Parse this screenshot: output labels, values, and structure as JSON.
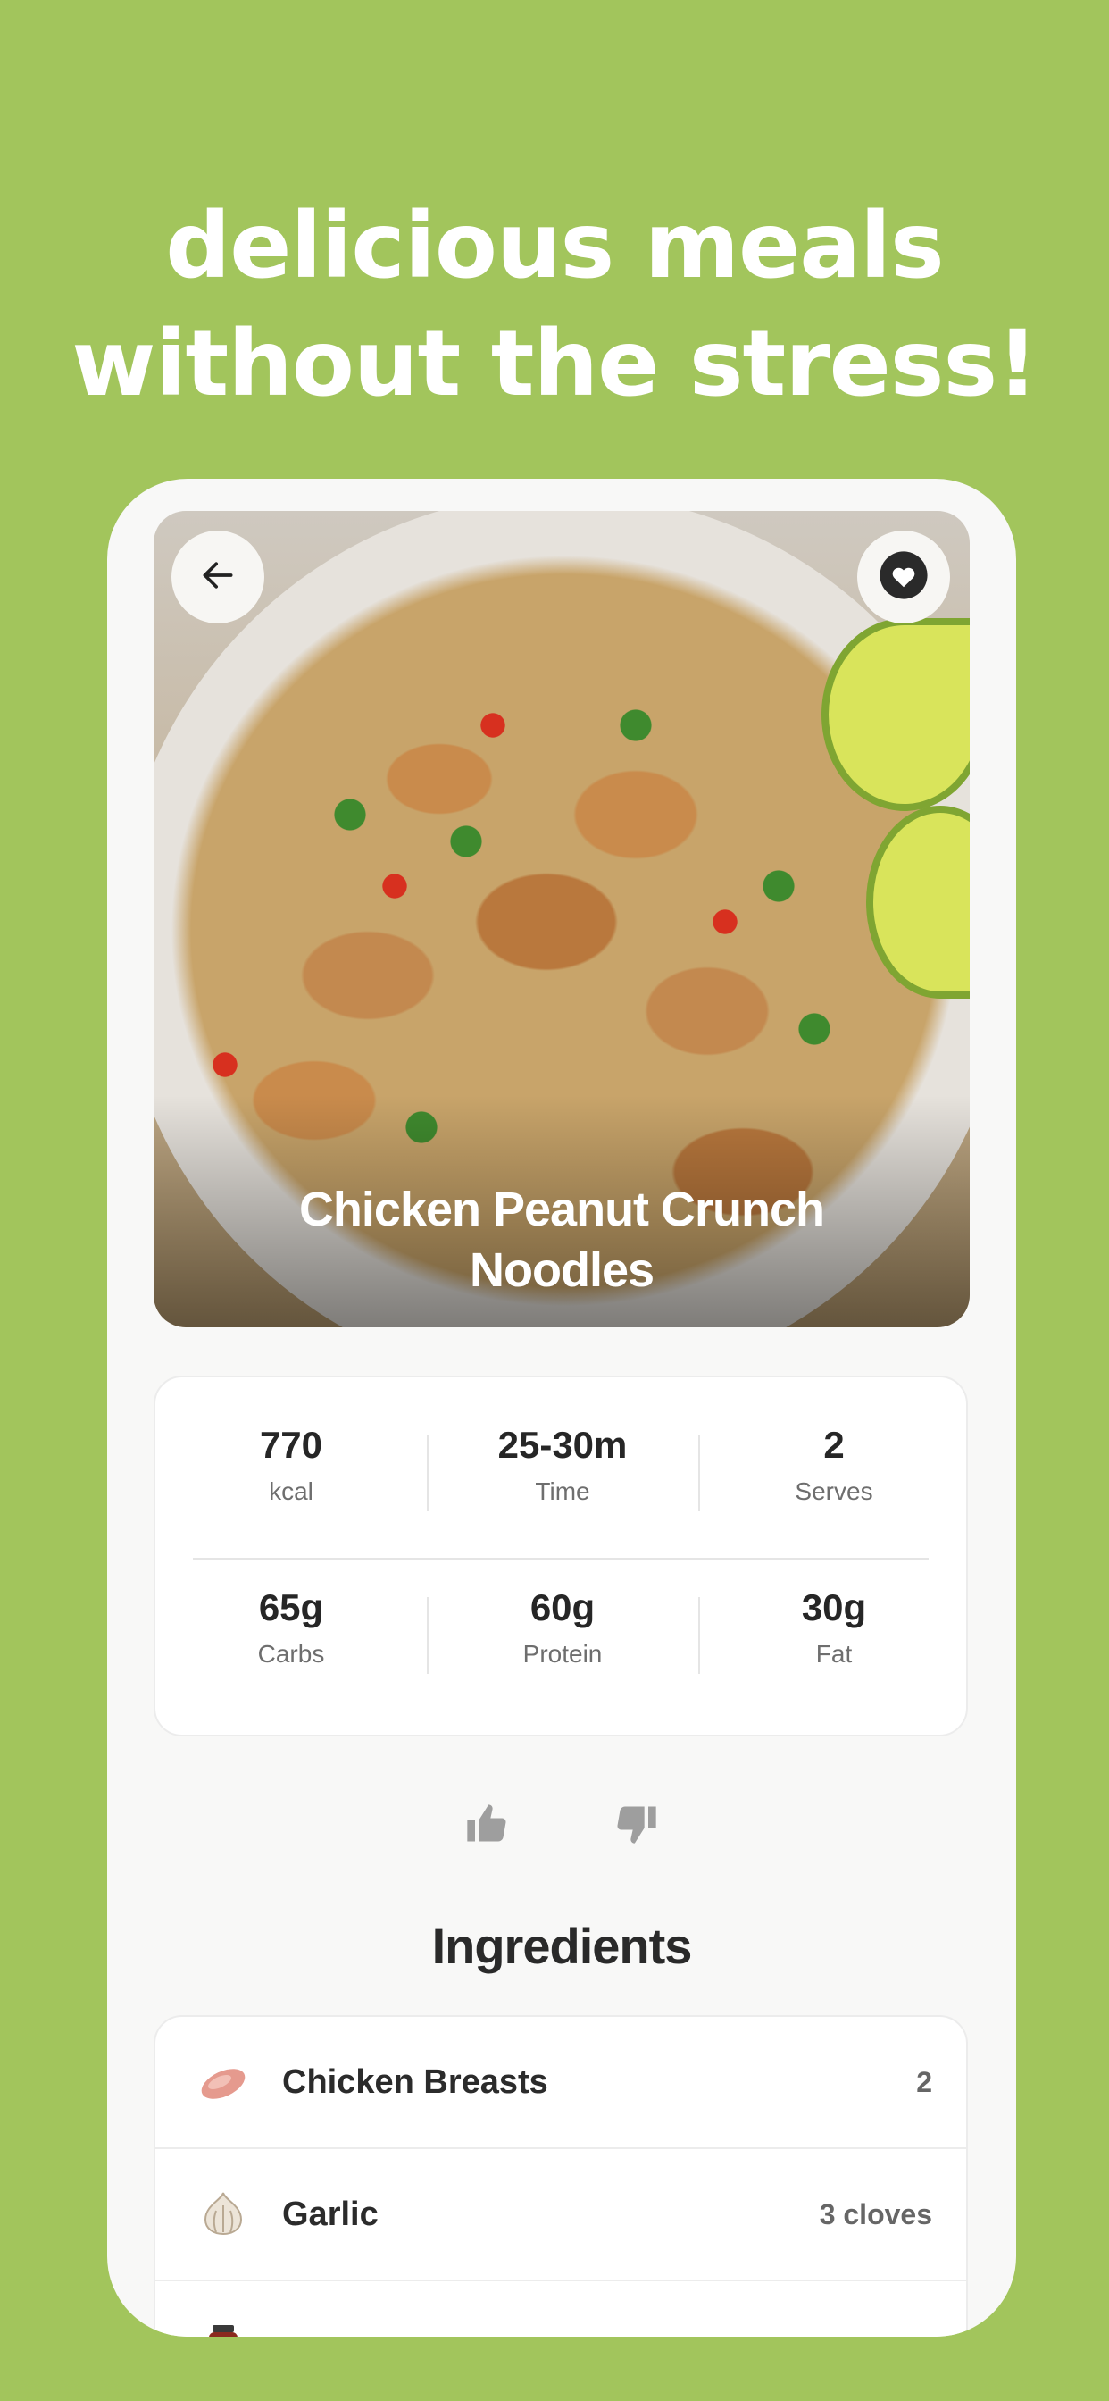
{
  "headline": {
    "line1": "delicious meals",
    "line2": "without the stress!"
  },
  "recipe": {
    "title_line1": "Chicken Peanut Crunch",
    "title_line2": "Noodles",
    "back_icon": "arrow-left-icon",
    "favorite_icon": "heart-icon"
  },
  "stats": [
    {
      "value": "770",
      "label": "kcal"
    },
    {
      "value": "25-30m",
      "label": "Time"
    },
    {
      "value": "2",
      "label": "Serves"
    },
    {
      "value": "65g",
      "label": "Carbs"
    },
    {
      "value": "60g",
      "label": "Protein"
    },
    {
      "value": "30g",
      "label": "Fat"
    }
  ],
  "votes": {
    "like_icon": "thumbs-up-icon",
    "dislike_icon": "thumbs-down-icon"
  },
  "ingredients": {
    "title": "Ingredients",
    "items": [
      {
        "name": "Chicken Breasts",
        "qty": "2",
        "icon": "chicken-icon"
      },
      {
        "name": "Garlic",
        "qty": "3 cloves",
        "icon": "garlic-icon"
      },
      {
        "name": "",
        "qty": "",
        "icon": "jar-icon"
      }
    ]
  },
  "colors": {
    "background": "#a2c55c",
    "card": "#f8f8f7",
    "text_dark": "#262626",
    "text_muted": "#6e6e6e"
  }
}
